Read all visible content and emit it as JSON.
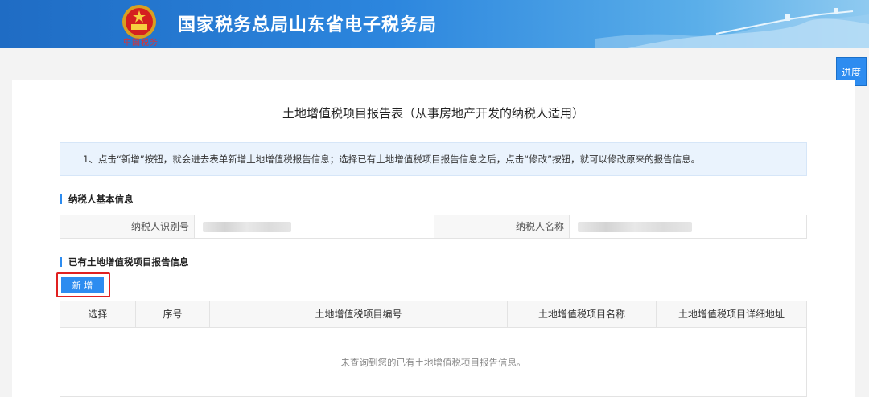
{
  "header": {
    "title": "国家税务总局山东省电子税务局",
    "logo_text": "中国税务"
  },
  "side": {
    "progress_label": "进度"
  },
  "form": {
    "title": "土地增值税项目报告表（从事房地产开发的纳税人适用）",
    "notice": "1、点击“新增”按钮，就会进去表单新增土地增值税报告信息；选择已有土地增值税项目报告信息之后，点击“修改”按钮，就可以修改原来的报告信息。"
  },
  "taxpayer": {
    "section_title": "纳税人基本信息",
    "id_label": "纳税人识别号",
    "name_label": "纳税人名称"
  },
  "reports": {
    "section_title": "已有土地增值税项目报告信息",
    "add_label": "新 增",
    "columns": [
      "选择",
      "序号",
      "土地增值税项目编号",
      "土地增值税项目名称",
      "土地增值税项目详细地址"
    ],
    "empty_text": "未查询到您的已有土地增值税项目报告信息。"
  },
  "colors": {
    "accent": "#2d8cf0",
    "highlight": "#e02020",
    "header_start": "#1f6cc4"
  }
}
